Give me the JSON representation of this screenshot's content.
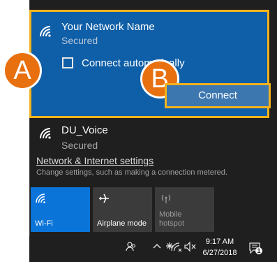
{
  "networks": {
    "selected": {
      "name": "Your Network Name",
      "status": "Secured",
      "auto_connect_label": "Connect automatically",
      "connect_label": "Connect"
    },
    "other": {
      "name": "DU_Voice",
      "status": "Secured"
    }
  },
  "callouts": {
    "a": "A",
    "b": "B"
  },
  "settings": {
    "link": "Network & Internet settings",
    "description": "Change settings, such as making a connection metered."
  },
  "quick_actions": [
    {
      "label": "Wi-Fi",
      "icon": "wifi-icon",
      "state": "on"
    },
    {
      "label": "Airplane mode",
      "icon": "airplane-icon",
      "state": "off"
    },
    {
      "label_line1": "Mobile",
      "label_line2": "hotspot",
      "icon": "hotspot-icon",
      "state": "disabled"
    }
  ],
  "taskbar": {
    "time": "9:17 AM",
    "date": "6/27/2018",
    "notification_count": "1"
  },
  "colors": {
    "selected_bg": "#0f5fa8",
    "highlight": "#f3b21b",
    "callout": "#e8700f",
    "tile_active": "#0a74d9"
  }
}
